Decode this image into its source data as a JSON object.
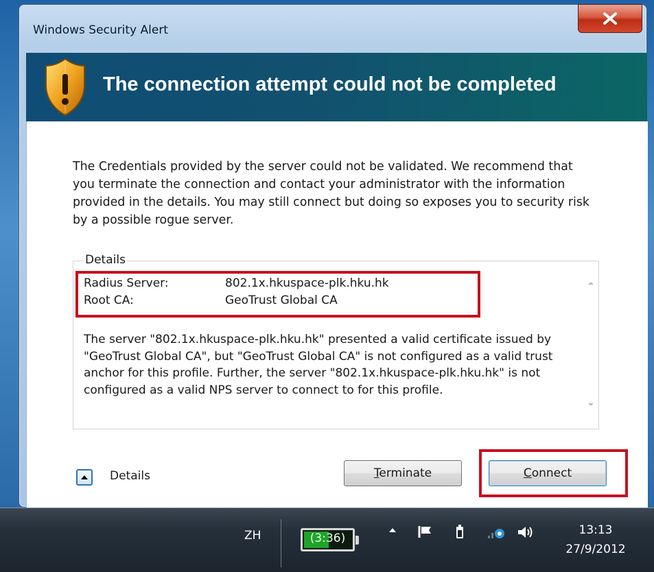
{
  "window": {
    "title": "Windows Security Alert",
    "close_label": "X"
  },
  "header": {
    "title": "The connection attempt could not be completed",
    "icon": "shield-warning-icon"
  },
  "message": "The Credentials provided by the server could not be validated. We recommend that you terminate the connection and contact your administrator with the information provided in the details. You may still connect but doing so exposes you to security risk by a possible rogue server.",
  "details": {
    "legend": "Details",
    "fields": [
      {
        "key": "Radius Server:",
        "value": "802.1x.hkuspace-plk.hku.hk"
      },
      {
        "key": "Root CA:",
        "value": "GeoTrust Global CA"
      }
    ],
    "description": "The server \"802.1x.hkuspace-plk.hku.hk\" presented a valid certificate issued by \"GeoTrust Global CA\", but \"GeoTrust Global CA\" is not configured as a valid trust anchor for this profile. Further, the server \"802.1x.hkuspace-plk.hku.hk\" is not configured as a valid NPS server to connect to for this profile."
  },
  "footer": {
    "details_toggle_label": "Details",
    "terminate_accesskey": "T",
    "terminate_rest": "erminate",
    "connect_accesskey": "C",
    "connect_rest": "onnect"
  },
  "taskbar": {
    "ime": "ZH",
    "battery_text": "(3:36)",
    "battery_level": 0.55,
    "time": "13:13",
    "date": "27/9/2012",
    "tray_icons": [
      "show-hidden-icons-arrow",
      "action-center-flag-icon",
      "power-plug-icon",
      "network-icon",
      "volume-icon"
    ]
  },
  "colors": {
    "header_gradient_start": "#0f4d76",
    "header_gradient_end": "#0b6664",
    "highlight_red": "#c8101e",
    "close_red": "#c8391f"
  }
}
